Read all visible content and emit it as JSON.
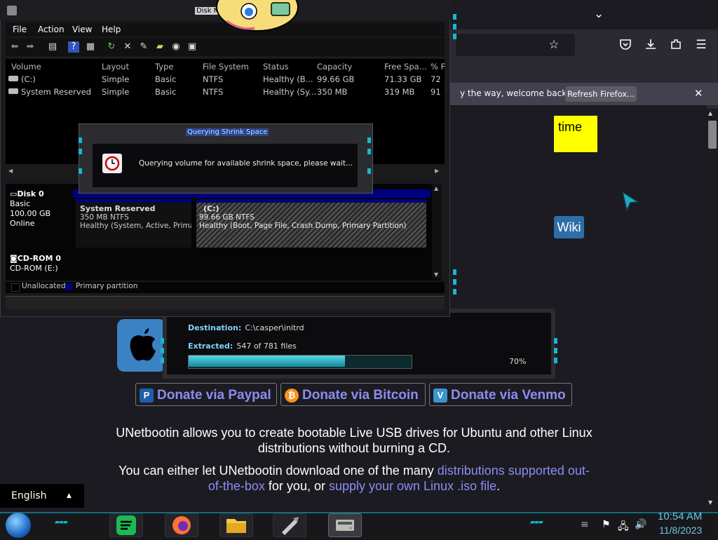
{
  "firefox": {
    "notification_text": "y the way, welcome back!",
    "refresh_label": "Refresh Firefox...",
    "close_glyph": "✕",
    "tab_list_glyph": "⌄",
    "icons": [
      "bookmark-star-icon",
      "pocket-icon",
      "downloads-icon",
      "extensions-icon",
      "menu-icon"
    ]
  },
  "page": {
    "yellow_box_text": "time",
    "wiki_button": "Wiki",
    "donate": [
      {
        "label": "Donate via Paypal",
        "icon": "P",
        "color": "#1f5fa8"
      },
      {
        "label": "Donate via Bitcoin",
        "icon": "₿",
        "color": "#f7931a"
      },
      {
        "label": "Donate via Venmo",
        "icon": "V",
        "color": "#3d95ce"
      }
    ],
    "para1": "UNetbootin allows you to create bootable Live USB drives for Ubuntu and other Linux distributions without burning a CD.",
    "para2_a": "You can either let UNetbootin download one of the many ",
    "para2_link1": "distributions supported out-of-the-box",
    "para2_b": " for you, or ",
    "para2_link2": "supply your own Linux .iso file",
    "para2_c": ".",
    "language": "English"
  },
  "unetbootin": {
    "destination_label": "Destination:",
    "destination_value": "C:\\casper\\initrd",
    "extracted_label": "Extracted:",
    "extracted_value": "547 of 781 files",
    "progress_fraction": 0.7,
    "progress_text": "70%"
  },
  "diskmgmt": {
    "title": "Disk M",
    "menu": [
      "File",
      "Action",
      "View",
      "Help"
    ],
    "columns": [
      "Volume",
      "Layout",
      "Type",
      "File System",
      "Status",
      "Capacity",
      "Free Spa...",
      "% F"
    ],
    "rows": [
      [
        "(C:)",
        "Simple",
        "Basic",
        "NTFS",
        "Healthy (B...",
        "99.66 GB",
        "71.33 GB",
        "72"
      ],
      [
        "System Reserved",
        "Simple",
        "Basic",
        "NTFS",
        "Healthy (Sy...",
        "350 MB",
        "319 MB",
        "91"
      ]
    ],
    "disk0": {
      "name": "Disk 0",
      "type": "Basic",
      "size": "100.00 GB",
      "state": "Online"
    },
    "sysres": {
      "name": "System Reserved",
      "size": "350 MB NTFS",
      "status": "Healthy (System, Active, Primary"
    },
    "cpart": {
      "name": "(C:)",
      "size": "99.66 GB NTFS",
      "status": "Healthy (Boot, Page File, Crash Dump, Primary Partition)"
    },
    "cdrom": {
      "name": "CD-ROM 0",
      "drive": "CD-ROM (E:)"
    },
    "legend": [
      "Unallocated",
      "Primary partition"
    ],
    "dialog": {
      "title": "Querying Shrink Space",
      "message": "Querying volume for available shrink space, please wait..."
    }
  },
  "taskbar": {
    "time": "10:54 AM",
    "date": "11/8/2023",
    "apps": [
      "spotify-icon",
      "firefox-icon",
      "file-explorer-icon",
      "unetbootin-icon",
      "disk-management-icon"
    ]
  }
}
